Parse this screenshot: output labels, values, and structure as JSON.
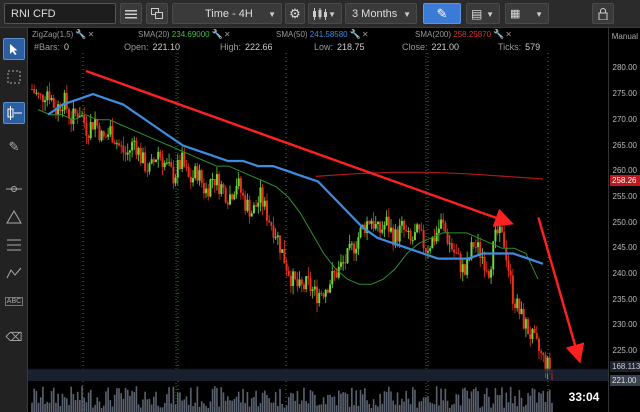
{
  "toolbar": {
    "symbol": "RNI CFD",
    "timeframe": "Time - 4H",
    "period": "3 Months"
  },
  "indicators": [
    {
      "name": "ZigZag(1,5)",
      "value": "",
      "color": "#aaaaaa"
    },
    {
      "name": "SMA(20)",
      "value": "234.69000",
      "color": "#3fbf3f"
    },
    {
      "name": "SMA(50)",
      "value": "241.58580",
      "color": "#3d8de0"
    },
    {
      "name": "SMA(200)",
      "value": "258.25870",
      "color": "#e03030"
    }
  ],
  "ohlc": {
    "bars_label": "#Bars:",
    "bars": "0",
    "open_label": "Open:",
    "open": "221.10",
    "high_label": "High:",
    "high": "222.66",
    "low_label": "Low:",
    "low": "218.75",
    "close_label": "Close:",
    "close": "221.00",
    "ticks_label": "Ticks:",
    "ticks": "579"
  },
  "axis": {
    "mode": "Manual",
    "ticks": [
      "280.00",
      "275.00",
      "270.00",
      "265.00",
      "260.00",
      "255.00",
      "250.00",
      "245.00",
      "240.00",
      "235.00",
      "230.00",
      "225.00"
    ],
    "price_tag": "258.26",
    "volume_tag": "168.113",
    "close_tag": "221.00"
  },
  "countdown": "33:04",
  "colors": {
    "up": "#6fd63a",
    "down": "#e8321e",
    "sma20": "#2f8f2f",
    "sma50": "#3d8de0",
    "sma200": "#b01818",
    "trendline": "#ff2020"
  },
  "chart_data": {
    "type": "candlestick",
    "ylim": [
      219,
      283
    ],
    "sma20": [
      272,
      271,
      271,
      270,
      271,
      270,
      270,
      269,
      268,
      267,
      266,
      265,
      264,
      263,
      262,
      261,
      261,
      260,
      259,
      258,
      257,
      255,
      252,
      248,
      244,
      241,
      239,
      238,
      238,
      239,
      241,
      244,
      246,
      247,
      248,
      248,
      248,
      247,
      246,
      245,
      245,
      244,
      239
    ],
    "sma50": [
      271,
      273,
      274,
      275,
      274,
      273,
      271,
      269,
      267,
      265,
      264,
      263,
      262,
      262,
      261,
      261,
      260,
      259,
      258,
      255,
      252,
      249,
      247,
      246,
      245,
      244,
      243,
      243,
      243,
      244,
      244,
      244,
      243,
      242
    ],
    "sma200": [
      259,
      259.5,
      259.8,
      259.8,
      259.5,
      259,
      258.5
    ],
    "trendlines": [
      {
        "from": [
          0.1,
          279.5
        ],
        "to": [
          0.83,
          250
        ]
      },
      {
        "from": [
          0.88,
          251
        ],
        "to": [
          0.95,
          223.5
        ]
      }
    ],
    "candles_seed": [
      276,
      274,
      276,
      272,
      274,
      270,
      272,
      268,
      270,
      266,
      268,
      265,
      263,
      266,
      262,
      260,
      264,
      261,
      259,
      262,
      258,
      260,
      256,
      259,
      257,
      255,
      258,
      254,
      252,
      255,
      251,
      248,
      243,
      239,
      237,
      238,
      236,
      237,
      239,
      241,
      243,
      246,
      249,
      251,
      248,
      250,
      247,
      249,
      246,
      248,
      245,
      247,
      250,
      246,
      243,
      240,
      246,
      244,
      241,
      248,
      246,
      236,
      232,
      229,
      226,
      223,
      221
    ]
  }
}
